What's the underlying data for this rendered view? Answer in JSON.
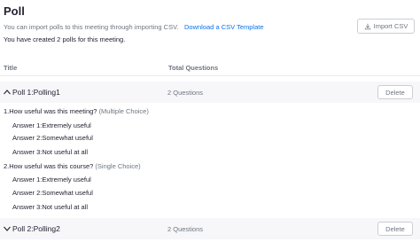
{
  "header": {
    "title": "Poll",
    "import_note": "You can import polls to this meeting through importing CSV.",
    "csv_link": "Download a CSV Template",
    "summary": "You have created 2 polls for this meeting.",
    "import_button": "Import CSV"
  },
  "table": {
    "col_title": "Title",
    "col_questions": "Total Questions"
  },
  "polls": [
    {
      "name": "Poll 1:Polling1",
      "count": "2 Questions",
      "delete_label": "Delete",
      "expanded": true,
      "questions": [
        {
          "text": "1.How useful was this meeting?",
          "type": "(Multiple Choice)",
          "answers": [
            "Answer 1:Extremely useful",
            "Answer 2:Somewhat useful",
            "Answer 3:Not useful at all"
          ]
        },
        {
          "text": "2.How useful was this course?",
          "type": "(Single Choice)",
          "answers": [
            "Answer 1:Extremely useful",
            "Answer 2:Somewhat useful",
            "Answer 3:Not useful at all"
          ]
        }
      ]
    },
    {
      "name": "Poll 2:Polling2",
      "count": "2 Questions",
      "delete_label": "Delete",
      "expanded": false
    }
  ],
  "colors": {
    "link": "#0e72ed",
    "text": "#232333",
    "muted": "#6e7680",
    "row_bg": "#f7f7fa"
  }
}
